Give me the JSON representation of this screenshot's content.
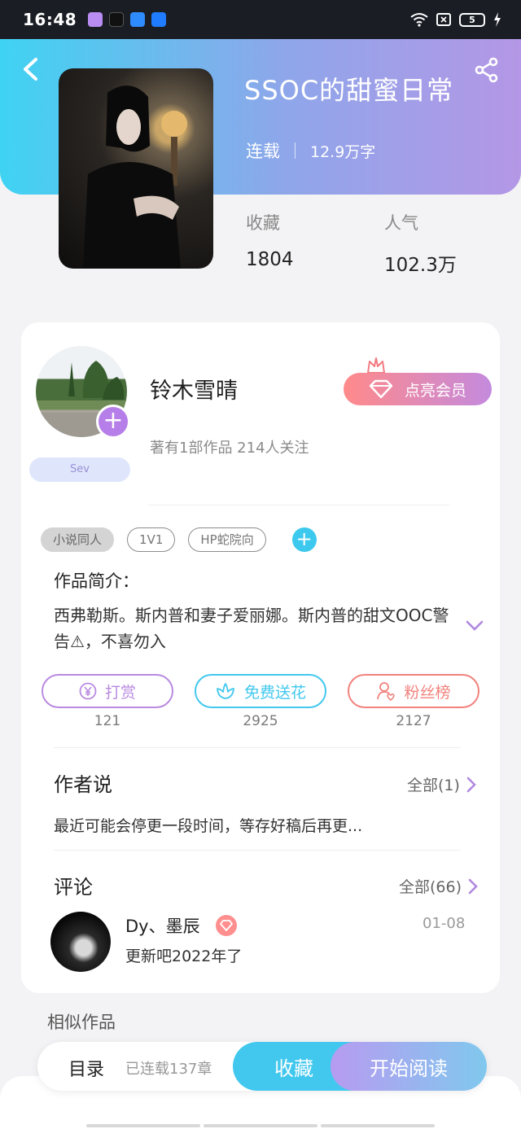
{
  "status_bar": {
    "time": "16:48",
    "battery": "5",
    "apps": [
      "#b98cf2",
      "#111111",
      "#2f8cff",
      "#1f7cff"
    ]
  },
  "book": {
    "title": "SSOC的甜蜜日常",
    "status": "连载",
    "words": "12.9万字",
    "stats": [
      {
        "label": "收藏",
        "value": "1804"
      },
      {
        "label": "人气",
        "value": "102.3万"
      }
    ]
  },
  "author": {
    "name": "铃木雪晴",
    "stats": "著有1部作品 214人关注",
    "badge": "Sev",
    "vip_label": "点亮会员"
  },
  "tags": [
    "小说同人",
    "1V1",
    "HP蛇院向"
  ],
  "intro": {
    "heading": "作品简介：",
    "text": "西弗勒斯。斯内普和妻子爱丽娜。斯内普的甜文OOC警告⚠，不喜勿入"
  },
  "actions": [
    {
      "label": "打赏",
      "count": "121",
      "color": "#b98ae0",
      "icon": "yen-icon"
    },
    {
      "label": "免费送花",
      "count": "2925",
      "color": "#42c8ee",
      "icon": "flower-icon"
    },
    {
      "label": "粉丝榜",
      "count": "2127",
      "color": "#f2827d",
      "icon": "fan-icon"
    }
  ],
  "author_says": {
    "heading": "作者说",
    "more": "全部(1)",
    "text": "最近可能会停更一段时间，等存好稿后再更..."
  },
  "comments": {
    "heading": "评论",
    "more": "全部(66)",
    "item": {
      "name": "Dy、墨辰",
      "date": "01-08",
      "text": "更新吧2022年了"
    }
  },
  "similar_heading": "相似作品",
  "bottom_bar": {
    "toc": "目录",
    "chapters": "已连载137章",
    "collect": "收藏",
    "read": "开始阅读"
  }
}
